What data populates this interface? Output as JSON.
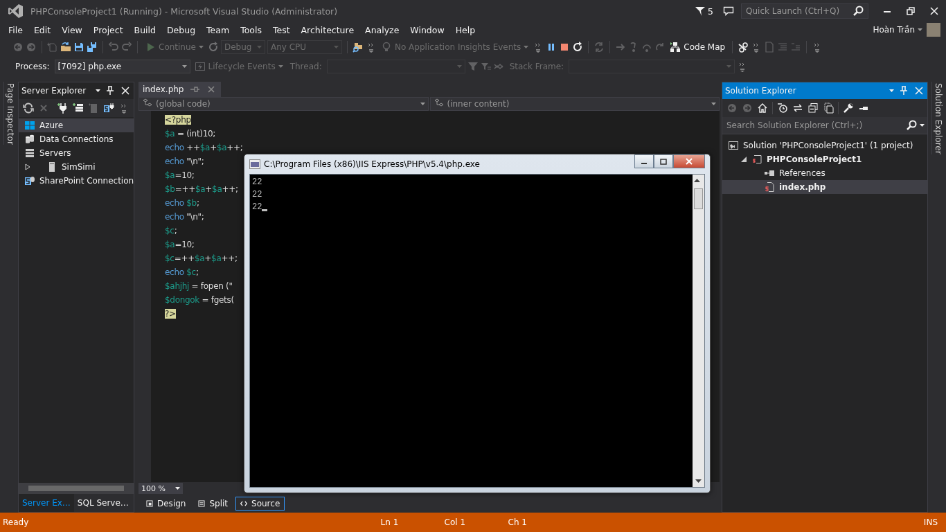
{
  "window": {
    "title": "PHPConsoleProject1 (Running) - Microsoft Visual Studio (Administrator)",
    "notifications": "5",
    "quick_launch": {
      "placeholder": "Quick Launch (Ctrl+Q)"
    }
  },
  "menu": [
    "File",
    "Edit",
    "View",
    "Project",
    "Build",
    "Debug",
    "Team",
    "Tools",
    "Test",
    "Architecture",
    "Analyze",
    "Window",
    "Help"
  ],
  "user": {
    "name": "Hoàn Trần"
  },
  "toolbars": [
    {
      "items": [
        {
          "kind": "icon",
          "disabled": true
        },
        {
          "kind": "icon",
          "disabled": true
        },
        {
          "kind": "sep"
        },
        {
          "kind": "icon",
          "disabled": true
        },
        {
          "kind": "icon",
          "disabled": false
        },
        {
          "kind": "icon",
          "disabled": false
        },
        {
          "kind": "icon",
          "disabled": false
        },
        {
          "kind": "sep"
        },
        {
          "kind": "icon",
          "disabled": true
        },
        {
          "kind": "icon",
          "disabled": true
        },
        {
          "kind": "sep"
        },
        {
          "kind": "button",
          "label": "Continue",
          "disabled": true,
          "dropdown": true
        },
        {
          "kind": "icon",
          "disabled": true
        },
        {
          "kind": "combo",
          "value": "Debug",
          "disabled": true
        },
        {
          "kind": "combo",
          "value": "Any CPU",
          "disabled": true
        },
        {
          "kind": "sep"
        },
        {
          "kind": "icon",
          "disabled": false
        },
        {
          "kind": "overflow"
        },
        {
          "kind": "button",
          "label": "No Application Insights Events",
          "disabled": true,
          "dropdown": true
        },
        {
          "kind": "overflow"
        },
        {
          "kind": "icon",
          "disabled": false
        },
        {
          "kind": "icon",
          "disabled": false
        },
        {
          "kind": "icon",
          "disabled": false
        },
        {
          "kind": "sep"
        },
        {
          "kind": "icon",
          "disabled": true
        },
        {
          "kind": "sep"
        },
        {
          "kind": "icon",
          "disabled": true
        },
        {
          "kind": "icon",
          "disabled": true
        },
        {
          "kind": "icon",
          "disabled": true
        },
        {
          "kind": "icon",
          "disabled": true
        },
        {
          "kind": "button",
          "label": "Code Map",
          "disabled": false,
          "dropdown": false
        },
        {
          "kind": "sep"
        },
        {
          "kind": "icon",
          "disabled": false
        },
        {
          "kind": "overflow"
        },
        {
          "kind": "icon",
          "disabled": true
        },
        {
          "kind": "icon",
          "disabled": true
        },
        {
          "kind": "icon",
          "disabled": true
        },
        {
          "kind": "sep"
        },
        {
          "kind": "overflow"
        }
      ]
    },
    {
      "items": [
        {
          "kind": "label",
          "label": "Process:",
          "disabled": false
        },
        {
          "kind": "combo",
          "value": "[7092] php.exe",
          "disabled": false
        },
        {
          "kind": "button",
          "label": "Lifecycle Events",
          "disabled": true,
          "dropdown": true
        },
        {
          "kind": "label",
          "label": "Thread:",
          "disabled": true
        },
        {
          "kind": "combo",
          "disabled": true
        },
        {
          "kind": "icon",
          "disabled": true
        },
        {
          "kind": "icon",
          "disabled": true
        },
        {
          "kind": "icon",
          "disabled": true
        },
        {
          "kind": "label",
          "label": "Stack Frame:",
          "disabled": true
        },
        {
          "kind": "combo",
          "disabled": true
        },
        {
          "kind": "overflow"
        }
      ]
    }
  ],
  "side_tabs": {
    "left": "Page Inspector",
    "right": "Solution Explorer"
  },
  "server_explorer": {
    "title": "Server Explorer",
    "tools": [
      {
        "kind": "icon",
        "disabled": false
      },
      {
        "kind": "icon",
        "disabled": true
      },
      {
        "kind": "sep"
      },
      {
        "kind": "icon",
        "disabled": false
      },
      {
        "kind": "icon",
        "disabled": false
      },
      {
        "kind": "icon",
        "disabled": true
      },
      {
        "kind": "icon",
        "disabled": false
      }
    ],
    "tree": [
      {
        "label": "Azure",
        "kind": "cloud",
        "selected": true
      },
      {
        "label": "Data Connections",
        "kind": "database",
        "selected": false
      },
      {
        "label": "Servers",
        "kind": "servers",
        "selected": false
      },
      {
        "label": "SimSimi",
        "kind": "server",
        "selected": false,
        "expanded": false
      },
      {
        "label": "SharePoint Connection",
        "kind": "sharepoint",
        "selected": false
      }
    ],
    "tabs": [
      {
        "label": "Server Ex…",
        "selected": true
      },
      {
        "label": "SQL Serve…",
        "selected": false
      }
    ]
  },
  "editor": {
    "tab": "index.php",
    "nav": [
      "(global code)",
      "(inner content)"
    ],
    "lines": [
      [
        {
          "kind": "delim",
          "text": "<?php"
        }
      ],
      [
        {
          "kind": "var",
          "text": "$a"
        },
        {
          "kind": "plain",
          "text": " = (int)10;"
        }
      ],
      [
        {
          "kind": "kw",
          "text": "echo"
        },
        {
          "kind": "plain",
          "text": " ++"
        },
        {
          "kind": "var",
          "text": "$a"
        },
        {
          "kind": "plain",
          "text": "+"
        },
        {
          "kind": "var",
          "text": "$a"
        },
        {
          "kind": "plain",
          "text": "++;"
        }
      ],
      [
        {
          "kind": "kw",
          "text": "echo"
        },
        {
          "kind": "plain",
          "text": " \"\\n\";"
        }
      ],
      [
        {
          "kind": "var",
          "text": "$a"
        },
        {
          "kind": "plain",
          "text": "=10;"
        }
      ],
      [
        {
          "kind": "var",
          "text": "$b"
        },
        {
          "kind": "plain",
          "text": "=++"
        },
        {
          "kind": "var",
          "text": "$a"
        },
        {
          "kind": "plain",
          "text": "+"
        },
        {
          "kind": "var",
          "text": "$a"
        },
        {
          "kind": "plain",
          "text": "++;"
        }
      ],
      [
        {
          "kind": "kw",
          "text": "echo "
        },
        {
          "kind": "var",
          "text": "$b"
        },
        {
          "kind": "plain",
          "text": ";"
        }
      ],
      [
        {
          "kind": "kw",
          "text": "echo"
        },
        {
          "kind": "plain",
          "text": " \"\\n\";"
        }
      ],
      [
        {
          "kind": "var",
          "text": "$c"
        },
        {
          "kind": "plain",
          "text": ";"
        }
      ],
      [
        {
          "kind": "var",
          "text": "$a"
        },
        {
          "kind": "plain",
          "text": "=10;"
        }
      ],
      [
        {
          "kind": "var",
          "text": "$c"
        },
        {
          "kind": "plain",
          "text": "=++"
        },
        {
          "kind": "var",
          "text": "$a"
        },
        {
          "kind": "plain",
          "text": "+"
        },
        {
          "kind": "var",
          "text": "$a"
        },
        {
          "kind": "plain",
          "text": "++;"
        }
      ],
      [
        {
          "kind": "kw",
          "text": "echo "
        },
        {
          "kind": "var",
          "text": "$c"
        },
        {
          "kind": "plain",
          "text": ";"
        }
      ],
      [
        {
          "kind": "var",
          "text": "$ahjhj"
        },
        {
          "kind": "plain",
          "text": " = fopen (\""
        }
      ],
      [
        {
          "kind": "var",
          "text": "$dongok"
        },
        {
          "kind": "plain",
          "text": " = fgets("
        }
      ],
      [
        {
          "kind": "delim",
          "text": "?>"
        }
      ]
    ],
    "zoom": "100 %",
    "views": [
      {
        "label": "Design",
        "selected": false
      },
      {
        "label": "Split",
        "selected": false
      },
      {
        "label": "Source",
        "selected": true
      }
    ]
  },
  "console": {
    "title": "C:\\Program Files (x86)\\IIS Express\\PHP\\v5.4\\php.exe",
    "output": [
      "22",
      "22",
      "22"
    ]
  },
  "solution_explorer": {
    "title": "Solution Explorer",
    "search": {
      "placeholder": "Search Solution Explorer (Ctrl+;)"
    },
    "tree": [
      {
        "label": "Solution 'PHPConsoleProject1' (1 project)",
        "kind": "solution",
        "bold": false,
        "selected": false,
        "children": [
          {
            "label": "PHPConsoleProject1",
            "kind": "project",
            "bold": true,
            "selected": false,
            "expanded": true,
            "children": [
              {
                "label": "References",
                "kind": "references",
                "bold": false,
                "selected": false
              },
              {
                "label": "index.php",
                "kind": "file",
                "bold": true,
                "selected": true
              }
            ]
          }
        ]
      }
    ]
  },
  "status_bar": {
    "message": "Ready",
    "line": "Ln 1",
    "col": "Col 1",
    "ch": "Ch 1",
    "mode": "INS"
  }
}
